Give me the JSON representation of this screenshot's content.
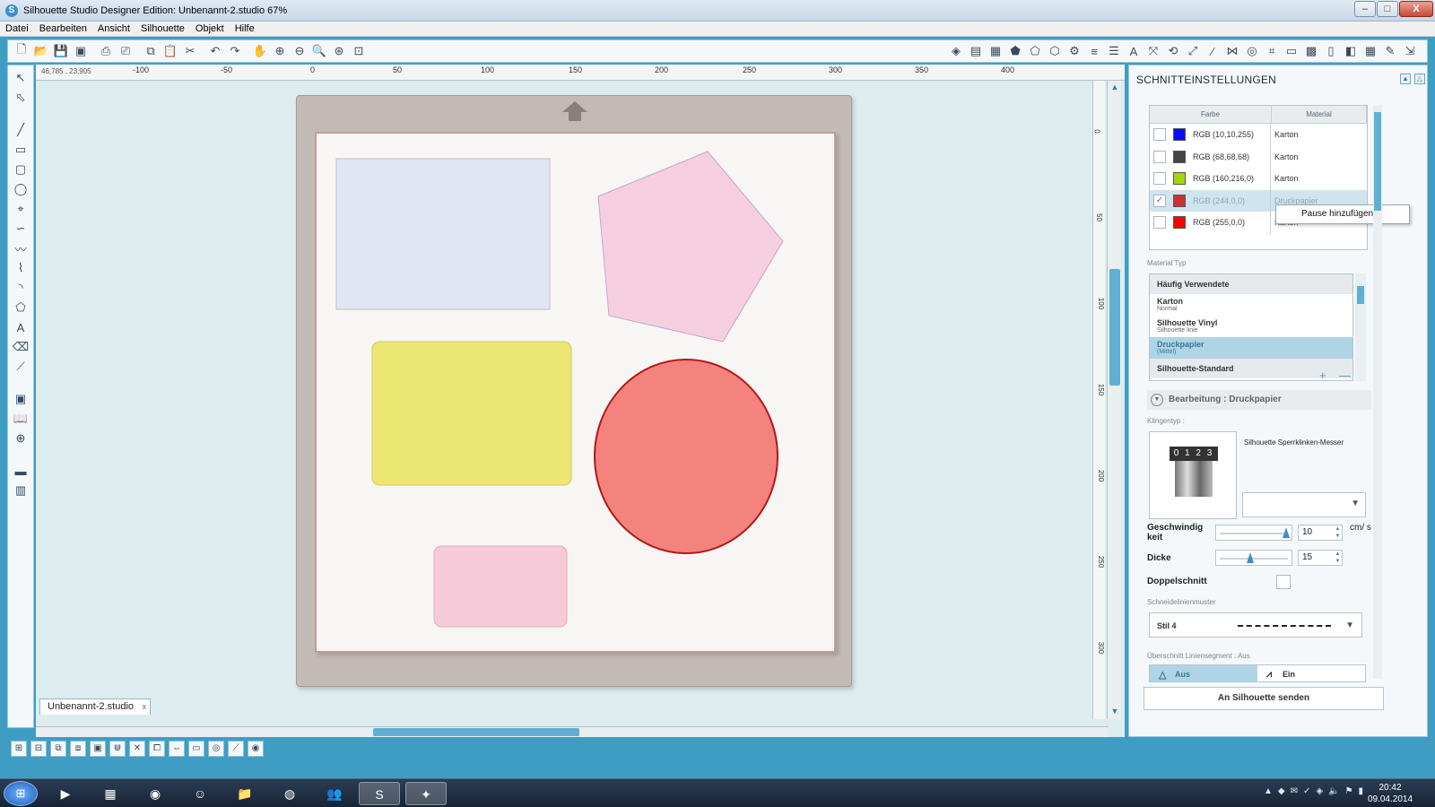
{
  "window": {
    "title": "Silhouette Studio Designer Edition: Unbenannt-2.studio 67%",
    "min": "–",
    "max": "□",
    "close": "X"
  },
  "menu": [
    "Datei",
    "Bearbeiten",
    "Ansicht",
    "Silhouette",
    "Objekt",
    "Hilfe"
  ],
  "canvas": {
    "coords": "46,785 , 23,905",
    "ruler_ticks": [
      "-100",
      "-50",
      "0",
      "50",
      "100",
      "150",
      "200",
      "250",
      "300",
      "350",
      "400"
    ],
    "ruler_right_ticks": [
      "0",
      "50",
      "100",
      "150",
      "200",
      "250",
      "300"
    ],
    "doc_tab": "Unbenannt-2.studio",
    "doc_tab_close": "x",
    "shapes": [
      {
        "name": "light-blue-rectangle",
        "fill": "#e0e6f2"
      },
      {
        "name": "pink-pentagon",
        "fill": "#f5cfe0"
      },
      {
        "name": "yellow-rounded-rectangle",
        "fill": "#ece673"
      },
      {
        "name": "red-circle",
        "fill": "#f5837d"
      },
      {
        "name": "pink-rounded-rectangle",
        "fill": "#f5cbd9"
      }
    ]
  },
  "panel": {
    "title": "SCHNITTEINSTELLUNGEN",
    "color_table": {
      "col_farbe": "Farbe",
      "col_material": "Material",
      "rows": [
        {
          "rgb": "RGB (10,10,255)",
          "swatch": "#0a0aff",
          "material": "Karton",
          "checked": ""
        },
        {
          "rgb": "RGB (68,68,68)",
          "swatch": "#444444",
          "material": "Karton",
          "checked": ""
        },
        {
          "rgb": "RGB (160,216,0)",
          "swatch": "#a0d800",
          "material": "Karton",
          "checked": ""
        },
        {
          "rgb": "RGB (244,0,0)",
          "swatch": "#c83232",
          "material": "Druckpapier",
          "checked": "✓"
        },
        {
          "rgb": "RGB (255,0,0)",
          "swatch": "#ff0000",
          "material": "Karton",
          "checked": ""
        }
      ]
    },
    "context_menu": "Pause hinzufügen",
    "material_type_label": "Material Typ",
    "material_groups": [
      {
        "label": "Häufig Verwendete"
      }
    ],
    "materials": [
      {
        "name": "Karton",
        "sub": "Normal",
        "selected": false
      },
      {
        "name": "Silhouette Vinyl",
        "sub": "Silhouette linie",
        "selected": false
      },
      {
        "name": "Druckpapier",
        "sub": "(Mittel)",
        "selected": true
      }
    ],
    "material_group_2": "Silhouette-Standard",
    "add": "+",
    "remove": "—",
    "edit_header": "Bearbeitung : Druckpapier",
    "blade_type_label": "Klingentyp :",
    "blade_digits": "0 1 2 3 4",
    "blade_name": "Silhouette Sperrklinken-Messer",
    "speed_label": "Geschwindig keit",
    "speed_value": "10",
    "speed_level": 1.0,
    "speed_unit": "cm/ s",
    "thickness_label": "Dicke",
    "thickness_value": "15",
    "thickness_level": 0.45,
    "double_cut_label": "Doppelschnitt",
    "line_pattern_label": "Schneidelinienmuster",
    "line_style": "Stil 4",
    "overcut_label": "Überschnitt Liniensegment : Aus",
    "overcut_off": "Aus",
    "overcut_on": "Ein",
    "send_button": "An Silhouette senden"
  },
  "taskbar": {
    "time": "20:42",
    "date": "09.04.2014"
  }
}
